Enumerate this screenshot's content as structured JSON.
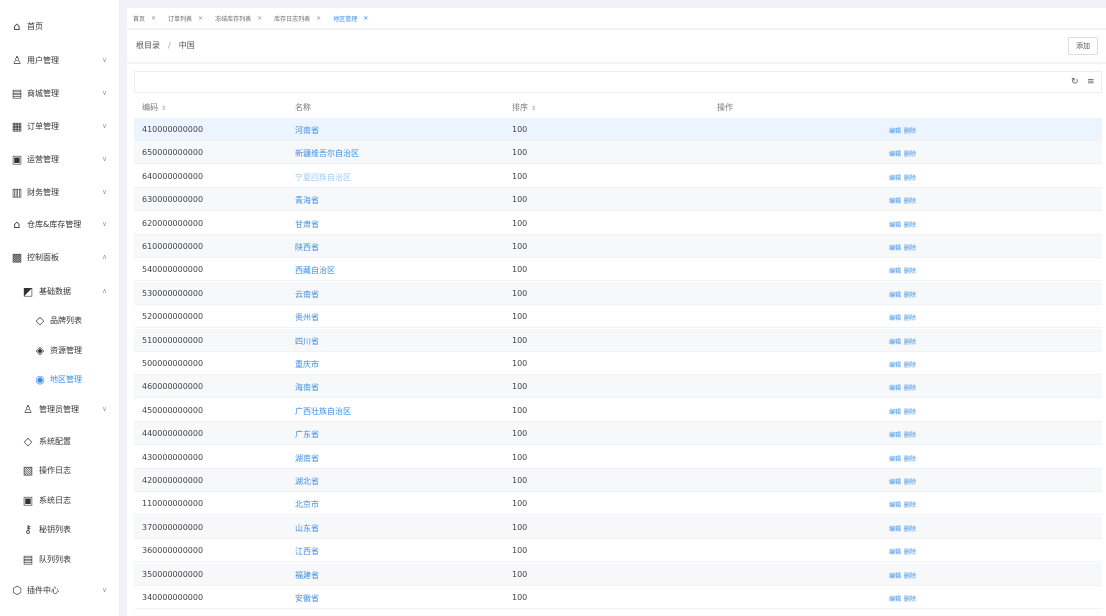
{
  "sidebar": {
    "items": [
      {
        "label": "首页",
        "icon": "home-icon",
        "glyph": "⌂"
      },
      {
        "label": "用户管理",
        "icon": "user-icon",
        "glyph": "♙"
      },
      {
        "label": "商城管理",
        "icon": "shop-icon",
        "glyph": "▤"
      },
      {
        "label": "订单管理",
        "icon": "order-icon",
        "glyph": "▦"
      },
      {
        "label": "运营管理",
        "icon": "operation-icon",
        "glyph": "▣"
      },
      {
        "label": "财务管理",
        "icon": "finance-icon",
        "glyph": "▥"
      },
      {
        "label": "仓库&库存管理",
        "icon": "warehouse-icon",
        "glyph": "⌂"
      },
      {
        "label": "控制面板",
        "icon": "dashboard-icon",
        "glyph": "▩"
      },
      {
        "label": "基础数据",
        "icon": "basic-data-icon",
        "glyph": "◩"
      },
      {
        "label": "品牌列表",
        "icon": "tag-icon",
        "glyph": "◇"
      },
      {
        "label": "资源管理",
        "icon": "cube-icon",
        "glyph": "◈"
      },
      {
        "label": "地区管理",
        "icon": "location-icon",
        "glyph": "◉"
      },
      {
        "label": "管理员管理",
        "icon": "admin-icon",
        "glyph": "♙"
      },
      {
        "label": "系统配置",
        "icon": "config-icon",
        "glyph": "◇"
      },
      {
        "label": "操作日志",
        "icon": "operation-log-icon",
        "glyph": "▧"
      },
      {
        "label": "系统日志",
        "icon": "system-log-icon",
        "glyph": "▣"
      },
      {
        "label": "秘钥列表",
        "icon": "key-icon",
        "glyph": "⚷"
      },
      {
        "label": "队列列表",
        "icon": "queue-icon",
        "glyph": "▤"
      },
      {
        "label": "插件中心",
        "icon": "plugin-icon",
        "glyph": "⬡"
      }
    ]
  },
  "tabs": [
    {
      "label": "首页"
    },
    {
      "label": "订单列表"
    },
    {
      "label": "冻结库存列表"
    },
    {
      "label": "库存日志列表"
    },
    {
      "label": "地区管理"
    }
  ],
  "breadcrumb": {
    "root": "根目录",
    "sep": "/",
    "current": "中国"
  },
  "add_label": "添加",
  "toolbar": {
    "refresh_icon": "refresh-icon",
    "settings_icon": "column-settings-icon"
  },
  "table": {
    "headers": {
      "code": "编码",
      "name": "名称",
      "sort": "排序",
      "ops": "操作"
    },
    "edit_label": "编辑",
    "delete_label": "删除",
    "rows": [
      {
        "code": "410000000000",
        "name": "河南省",
        "sort": "100"
      },
      {
        "code": "650000000000",
        "name": "新疆维吾尔自治区",
        "sort": "100"
      },
      {
        "code": "640000000000",
        "name": "宁夏回族自治区",
        "sort": "100"
      },
      {
        "code": "630000000000",
        "name": "青海省",
        "sort": "100"
      },
      {
        "code": "620000000000",
        "name": "甘肃省",
        "sort": "100"
      },
      {
        "code": "610000000000",
        "name": "陕西省",
        "sort": "100"
      },
      {
        "code": "540000000000",
        "name": "西藏自治区",
        "sort": "100"
      },
      {
        "code": "530000000000",
        "name": "云南省",
        "sort": "100"
      },
      {
        "code": "520000000000",
        "name": "贵州省",
        "sort": "100"
      },
      {
        "code": "510000000000",
        "name": "四川省",
        "sort": "100"
      },
      {
        "code": "500000000000",
        "name": "重庆市",
        "sort": "100"
      },
      {
        "code": "460000000000",
        "name": "海南省",
        "sort": "100"
      },
      {
        "code": "450000000000",
        "name": "广西壮族自治区",
        "sort": "100"
      },
      {
        "code": "440000000000",
        "name": "广东省",
        "sort": "100"
      },
      {
        "code": "430000000000",
        "name": "湖南省",
        "sort": "100"
      },
      {
        "code": "420000000000",
        "name": "湖北省",
        "sort": "100"
      },
      {
        "code": "110000000000",
        "name": "北京市",
        "sort": "100"
      },
      {
        "code": "370000000000",
        "name": "山东省",
        "sort": "100"
      },
      {
        "code": "360000000000",
        "name": "江西省",
        "sort": "100"
      },
      {
        "code": "350000000000",
        "name": "福建省",
        "sort": "100"
      },
      {
        "code": "340000000000",
        "name": "安徽省",
        "sort": "100"
      }
    ]
  },
  "colors": {
    "accent": "#3a8ee6",
    "row_highlight": "#ecf5ff"
  }
}
